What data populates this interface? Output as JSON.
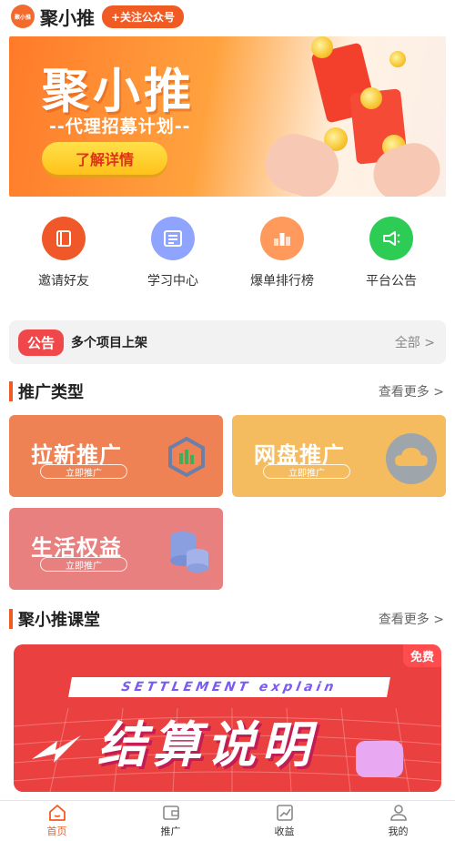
{
  "header": {
    "logo_text": "聚小推",
    "title": "聚小推",
    "follow_label": "+关注公众号"
  },
  "banner": {
    "title": "聚小推",
    "subtitle": "--代理招募计划--",
    "cta_label": "了解详情"
  },
  "quick_nav": [
    {
      "label": "邀请好友",
      "icon": "book-icon",
      "color": "#f0582a"
    },
    {
      "label": "学习中心",
      "icon": "list-icon",
      "color": "#8fa4ff"
    },
    {
      "label": "爆单排行榜",
      "icon": "ranking-icon",
      "color": "#ff9a5c"
    },
    {
      "label": "平台公告",
      "icon": "megaphone-icon",
      "color": "#2ccc55"
    }
  ],
  "notice": {
    "tag": "公告",
    "text": "多个项目上架",
    "all_label": "全部 >"
  },
  "promo_section": {
    "title": "推广类型",
    "more_label": "查看更多 >"
  },
  "promo_cards": [
    {
      "title": "拉新推广",
      "button": "立即推广",
      "icon": "hexagon-chart-icon",
      "color": "#ee8254"
    },
    {
      "title": "网盘推广",
      "button": "立即推广",
      "icon": "cloud-icon",
      "color": "#f4bc5f"
    },
    {
      "title": "生活权益",
      "button": "立即推广",
      "icon": "coins-stack-icon",
      "color": "#e8807f"
    }
  ],
  "class_section": {
    "title": "聚小推课堂",
    "more_label": "查看更多 >",
    "free_tag": "免费",
    "course_strip": "SETTLEMENT explain",
    "course_title": "结算说明"
  },
  "tabbar": [
    {
      "label": "首页",
      "icon": "home-icon",
      "active": true
    },
    {
      "label": "推广",
      "icon": "wallet-icon",
      "active": false
    },
    {
      "label": "收益",
      "icon": "chart-icon",
      "active": false
    },
    {
      "label": "我的",
      "icon": "user-icon",
      "active": false
    }
  ],
  "colors": {
    "brand": "#f05a23",
    "notice_tag": "#f0484a"
  }
}
